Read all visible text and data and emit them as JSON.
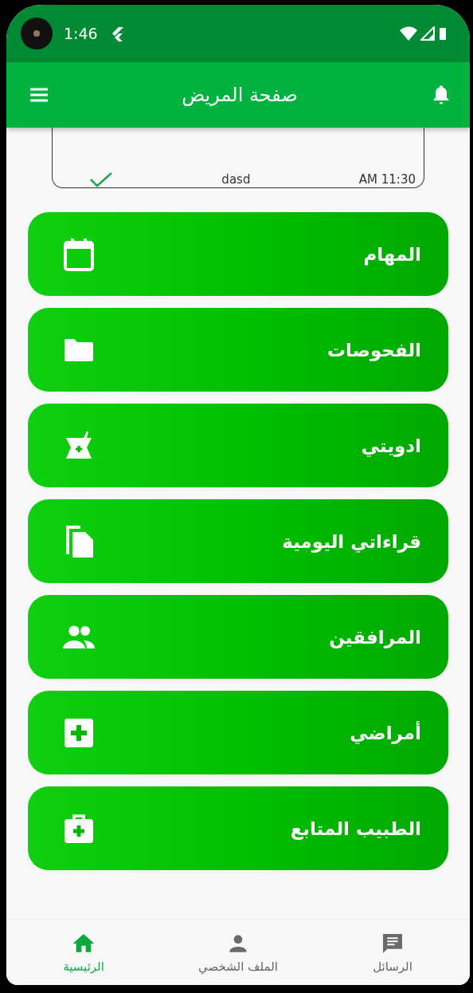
{
  "status_bar": {
    "time": "1:46"
  },
  "app_bar": {
    "title": "صفحة المريض"
  },
  "message_card": {
    "time": "AM 11:30",
    "text": "dasd",
    "read": true
  },
  "menu": [
    {
      "label": "المهام",
      "kind": "calendar"
    },
    {
      "label": "الفحوصات",
      "kind": "folder"
    },
    {
      "label": "ادويتي",
      "kind": "medicine"
    },
    {
      "label": "قراءاتي اليومية",
      "kind": "pages"
    },
    {
      "label": "المرافقين",
      "kind": "people"
    },
    {
      "label": "أمراضي",
      "kind": "plus"
    },
    {
      "label": "الطبيب المتابع",
      "kind": "bag"
    }
  ],
  "bottom_nav": [
    {
      "label": "الرسائل",
      "kind": "messages",
      "selected": false
    },
    {
      "label": "الملف الشخصي",
      "kind": "profile",
      "selected": false
    },
    {
      "label": "الرئيسية",
      "kind": "home",
      "selected": true
    }
  ]
}
